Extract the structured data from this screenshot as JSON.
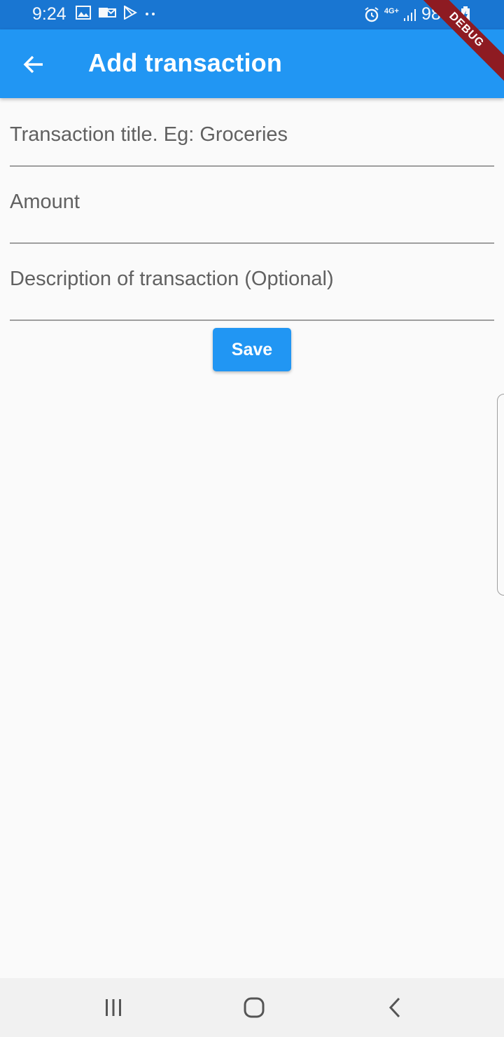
{
  "status_bar": {
    "time": "9:24",
    "battery": "98%",
    "network": "4G+",
    "icons_left": [
      "image-icon",
      "mail-icon",
      "play-store-icon",
      "more-dots-icon"
    ],
    "icons_right": [
      "alarm-icon",
      "network-4g-icon",
      "signal-icon",
      "battery-charging-icon"
    ]
  },
  "debug_banner": "DEBUG",
  "app_bar": {
    "title": "Add transaction",
    "back_icon": "arrow-back-icon",
    "color": "#2196f3"
  },
  "form": {
    "title_placeholder": "Transaction title. Eg: Groceries",
    "title_value": "",
    "amount_placeholder": "Amount",
    "amount_value": "",
    "description_placeholder": "Description of transaction (Optional)",
    "description_value": ""
  },
  "save_button": {
    "label": "Save",
    "color": "#2196f3"
  },
  "nav_bar": {
    "icons": [
      "recents-icon",
      "home-icon",
      "back-icon"
    ]
  }
}
